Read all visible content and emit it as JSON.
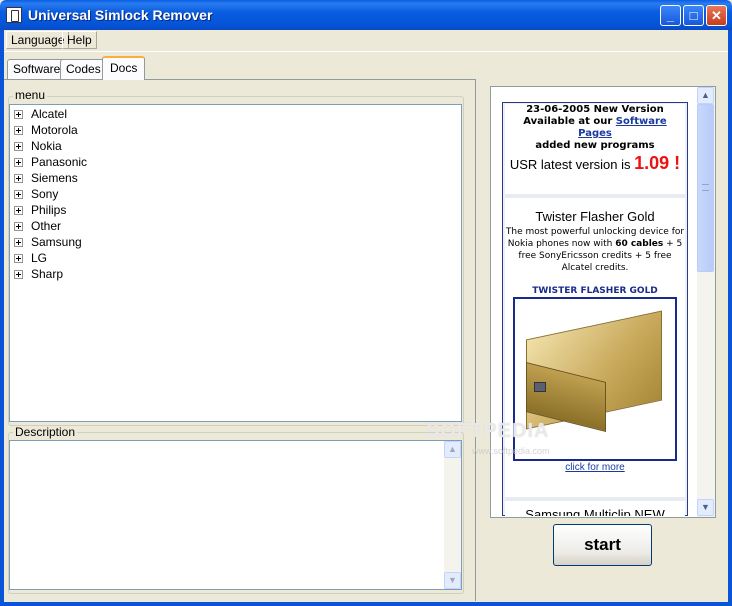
{
  "window": {
    "title": "Universal Simlock Remover",
    "minimize_glyph": "_",
    "maximize_glyph": "□",
    "close_glyph": "✕"
  },
  "menubar": {
    "items": [
      "Language",
      "Help"
    ]
  },
  "tabs": [
    {
      "label": "Software",
      "selected": false
    },
    {
      "label": "Codes",
      "selected": false
    },
    {
      "label": "Docs",
      "selected": true
    }
  ],
  "menu_group": {
    "label": "menu",
    "items": [
      "Alcatel",
      "Motorola",
      "Nokia",
      "Panasonic",
      "Siemens",
      "Sony",
      "Philips",
      "Other",
      "Samsung",
      "LG",
      "Sharp"
    ]
  },
  "description_group": {
    "label": "Description",
    "text": ""
  },
  "news": {
    "date_line": "23-06-2005 New Version",
    "available_prefix": "Available at our ",
    "available_link": "Software Pages",
    "added_line": "added new programs",
    "usr_prefix": "USR latest version is ",
    "usr_version": "1.09 !",
    "twister_title": "Twister Flasher Gold",
    "twister_desc_1": "The most powerful unlocking device for Nokia phones now with ",
    "twister_desc_bold": "60 cables",
    "twister_desc_2": " + 5 free SonyEricsson credits + 5 free Alcatel credits.",
    "twister_caption": "TWISTER FLASHER GOLD",
    "click_more": "click for more",
    "samsung_title": "Samsung Multiclip NEW"
  },
  "buttons": {
    "start": "start"
  },
  "watermark": {
    "main": "SOFTPEDIA",
    "sub": "www.softpedia.com"
  },
  "colors": {
    "titlebar": "#0a5ce0",
    "face": "#ece9d8",
    "version_red": "#ee1111",
    "link_blue": "#1a3aa0"
  }
}
